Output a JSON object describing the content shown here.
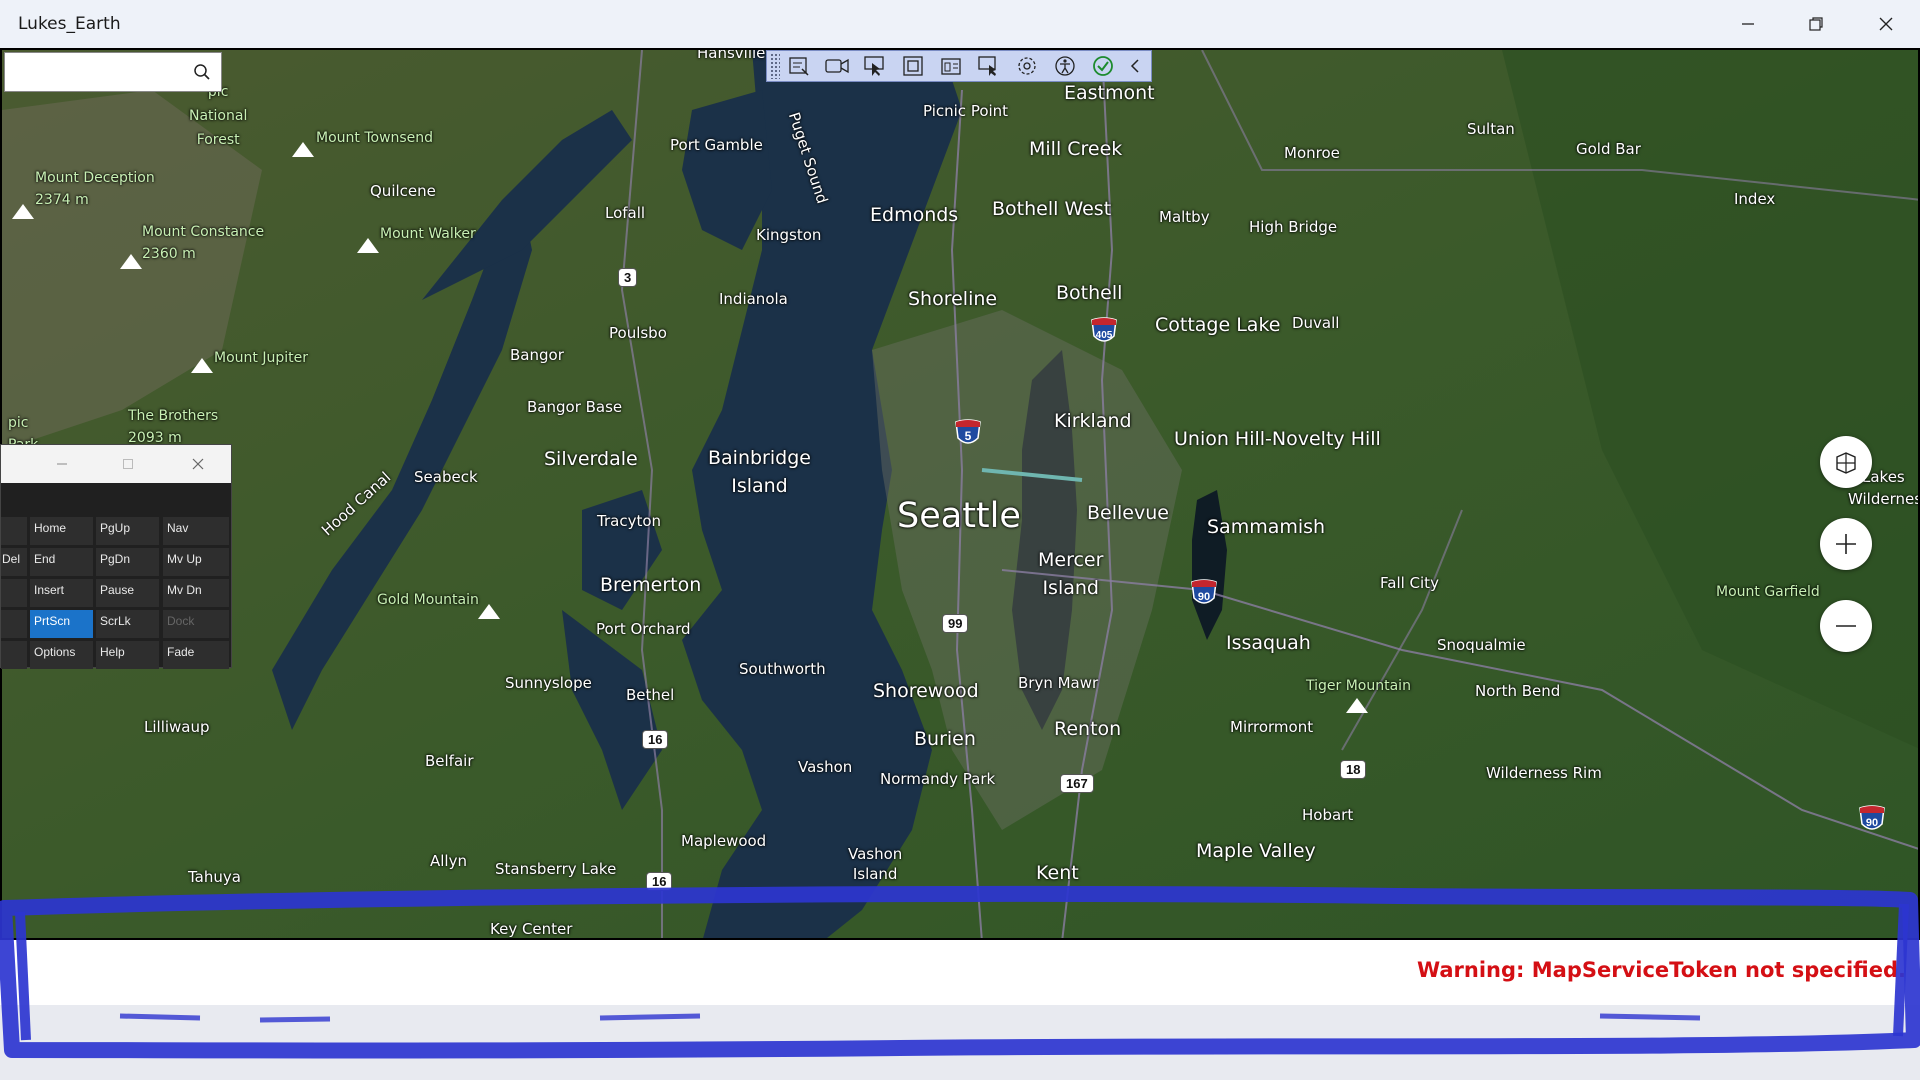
{
  "window": {
    "title": "Lukes_Earth",
    "minimize_icon": "minimize-icon",
    "maximize_icon": "restore-icon",
    "close_icon": "close-icon"
  },
  "search": {
    "value": "",
    "placeholder": "",
    "icon": "search-icon"
  },
  "toolbar": {
    "items": [
      "edit-list-icon",
      "record-icon",
      "select-pointer-icon",
      "frame-icon",
      "inspect-icon",
      "screen-select-icon",
      "track-focus-icon",
      "accessibility-icon",
      "check-icon",
      "collapse-chevron-icon"
    ]
  },
  "map_labels": {
    "hansville": "Hansville",
    "puget_sound": "Puget Sound",
    "eastmont": "Eastmont",
    "olympic_national_forest": "pic\nNational\nForest",
    "mount_townsend": "Mount Townsend",
    "picnic_point": "Picnic Point",
    "port_gamble": "Port Gamble",
    "mill_creek": "Mill Creek",
    "monroe": "Monroe",
    "sultan": "Sultan",
    "gold_bar": "Gold Bar",
    "mount_deception": "Mount Deception",
    "mount_deception_elev": "2374 m",
    "quilcene": "Quilcene",
    "edmonds": "Edmonds",
    "bothell_west": "Bothell West",
    "maltby": "Maltby",
    "high_bridge": "High Bridge",
    "index": "Index",
    "lofall": "Lofall",
    "kingston": "Kingston",
    "mount_constance": "Mount Constance",
    "mount_constance_elev": "2360 m",
    "mount_walker": "Mount Walker",
    "indianola": "Indianola",
    "shoreline": "Shoreline",
    "bothell": "Bothell",
    "cottage_lake": "Cottage Lake",
    "duvall": "Duvall",
    "poulsbo": "Poulsbo",
    "bangor": "Bangor",
    "mount_jupiter": "Mount Jupiter",
    "bangor_base": "Bangor Base",
    "the_brothers": "The Brothers",
    "the_brothers_elev": "2093 m",
    "olympic_park": "pic\nPark",
    "kirkland": "Kirkland",
    "union_hill": "Union Hill-Novelty Hill",
    "silverdale": "Silverdale",
    "bainbridge_island": "Bainbridge\nIsland",
    "seabeck": "Seabeck",
    "hood_canal": "Hood Canal",
    "seattle": "Seattle",
    "bellevue": "Bellevue",
    "tracyton": "Tracyton",
    "sammamish": "Sammamish",
    "alpine_lakes": "e Lakes\nWilderness",
    "mercer_island": "Mercer\nIsland",
    "bremerton": "Bremerton",
    "fall_city": "Fall City",
    "mount_garfield": "Mount Garfield",
    "gold_mountain": "Gold Mountain",
    "port_orchard": "Port Orchard",
    "issaquah": "Issaquah",
    "snoqualmie": "Snoqualmie",
    "southworth": "Southworth",
    "sunnyslope": "Sunnyslope",
    "bryn_mawr": "Bryn Mawr",
    "bethel": "Bethel",
    "shorewood": "Shorewood",
    "tiger_mountain": "Tiger Mountain",
    "north_bend": "North Bend",
    "lilliwaup": "Lilliwaup",
    "burien": "Burien",
    "renton": "Renton",
    "mirrormont": "Mirrormont",
    "belfair": "Belfair",
    "vashon": "Vashon",
    "normandy_park": "Normandy Park",
    "wilderness_rim": "Wilderness Rim",
    "hobart": "Hobart",
    "maplewood": "Maplewood",
    "vashon_island": "Vashon\nIsland",
    "maple_valley": "Maple Valley",
    "allyn": "Allyn",
    "tahuya": "Tahuya",
    "stansberry_lake": "Stansberry Lake",
    "kent": "Kent",
    "key_center": "Key Center"
  },
  "routes": {
    "r3": "3",
    "i405": "405",
    "i5": "5",
    "i90a": "90",
    "r99": "99",
    "r16a": "16",
    "r167": "167",
    "r18": "18",
    "r16b": "16",
    "i90b": "90"
  },
  "map_controls": {
    "style": "map-style-icon",
    "zoom_in": "zoom-in-icon",
    "zoom_out": "zoom-out-icon"
  },
  "keyboard": {
    "keys": [
      {
        "label": "Home"
      },
      {
        "label": "PgUp"
      },
      {
        "label": "Nav"
      },
      {
        "label": "Del"
      },
      {
        "label": "End"
      },
      {
        "label": "PgDn"
      },
      {
        "label": "Mv Up"
      },
      {
        "label": "Insert"
      },
      {
        "label": "Pause"
      },
      {
        "label": "Mv Dn"
      },
      {
        "label": "PrtScn"
      },
      {
        "label": "ScrLk"
      },
      {
        "label": "Dock"
      },
      {
        "label": "Options"
      },
      {
        "label": "Help"
      },
      {
        "label": "Fade"
      }
    ]
  },
  "status": {
    "warning": "Warning: MapServiceToken not specified."
  },
  "colors": {
    "annotation": "#2d35d0",
    "warning": "#d40f14",
    "key_selected": "#1b73c9"
  }
}
